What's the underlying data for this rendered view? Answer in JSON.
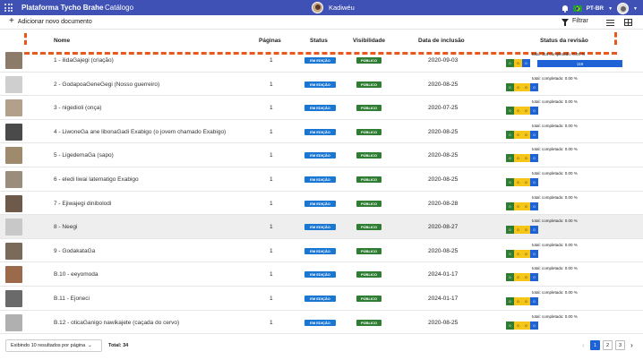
{
  "topbar": {
    "brand": "Plataforma Tycho Brahe",
    "section": "Catálogo",
    "user": "Kadiwéu",
    "lang": "PT-BR"
  },
  "toolbar": {
    "add_label": "Adicionar novo documento",
    "filter_label": "Filtrar"
  },
  "table": {
    "headers": {
      "name": "Nome",
      "pages": "Páginas",
      "status": "Status",
      "visibility": "Visibilidade",
      "date": "Data de inclusão",
      "review": "Status da revisão"
    },
    "rows": [
      {
        "name": "1 - ilidaGajegi (criação)",
        "pages": "1",
        "status": "EM EDIÇÃO",
        "visibility": "PÚBLICO",
        "date": "2020-09-03",
        "total": "total:  118  completado:  0.00 %",
        "bar": "118",
        "segs": [
          "0",
          "0",
          "0"
        ],
        "highlight": false
      },
      {
        "name": "2 - GodapoaGeneGegi (Nosso guerreiro)",
        "pages": "1",
        "status": "EM EDIÇÃO",
        "visibility": "PÚBLICO",
        "date": "2020-08-25",
        "total": "total:   completado:  0.00 %",
        "segs": [
          "0",
          "0",
          "0",
          "0"
        ],
        "highlight": false
      },
      {
        "name": "3 - nigedioli (onça)",
        "pages": "1",
        "status": "EM EDIÇÃO",
        "visibility": "PÚBLICO",
        "date": "2020-07-25",
        "total": "total:   completado:  0.00 %",
        "segs": [
          "0",
          "0",
          "0",
          "0"
        ],
        "highlight": false
      },
      {
        "name": "4 - LiwoneGa ane libonaGadi Exabigo (o jovem chamado Exabigo)",
        "pages": "1",
        "status": "EM EDIÇÃO",
        "visibility": "PÚBLICO",
        "date": "2020-08-25",
        "total": "total:   completado:  0.00 %",
        "segs": [
          "0",
          "0",
          "0",
          "0"
        ],
        "highlight": false
      },
      {
        "name": "5 - LigedemaGa (sapo)",
        "pages": "1",
        "status": "EM EDIÇÃO",
        "visibility": "PÚBLICO",
        "date": "2020-08-25",
        "total": "total:   completado:  0.00 %",
        "segs": [
          "0",
          "0",
          "0",
          "0"
        ],
        "highlight": false
      },
      {
        "name": "6 - eledi liwai latematigo Exabigo",
        "pages": "1",
        "status": "EM EDIÇÃO",
        "visibility": "PÚBLICO",
        "date": "2020-08-25",
        "total": "total:   completado:  0.00 %",
        "segs": [
          "0",
          "0",
          "0",
          "0"
        ],
        "highlight": false
      },
      {
        "name": "7 - Ejiwajegi dinibolodi",
        "pages": "1",
        "status": "EM EDIÇÃO",
        "visibility": "PÚBLICO",
        "date": "2020-08-28",
        "total": "total:   completado:  0.00 %",
        "segs": [
          "0",
          "0",
          "0",
          "0"
        ],
        "highlight": false
      },
      {
        "name": "8 - Neegi",
        "pages": "1",
        "status": "EM EDIÇÃO",
        "visibility": "PÚBLICO",
        "date": "2020-08-27",
        "total": "total:   completado:  0.00 %",
        "segs": [
          "0",
          "0",
          "0",
          "0"
        ],
        "highlight": true
      },
      {
        "name": "9 - GodakataGa",
        "pages": "1",
        "status": "EM EDIÇÃO",
        "visibility": "PÚBLICO",
        "date": "2020-08-25",
        "total": "total:   completado:  0.00 %",
        "segs": [
          "0",
          "0",
          "0",
          "0"
        ],
        "highlight": false
      },
      {
        "name": "B.10 - eeyomoda",
        "pages": "1",
        "status": "EM EDIÇÃO",
        "visibility": "PÚBLICO",
        "date": "2024-01-17",
        "total": "total:   completado:  0.00 %",
        "segs": [
          "0",
          "0",
          "0",
          "0"
        ],
        "highlight": false
      },
      {
        "name": "B.11 - Ejoneci",
        "pages": "1",
        "status": "EM EDIÇÃO",
        "visibility": "PÚBLICO",
        "date": "2024-01-17",
        "total": "total:   completado:  0.00 %",
        "segs": [
          "0",
          "0",
          "0",
          "0"
        ],
        "highlight": false
      },
      {
        "name": "B.12 - oticaGanigo nawikajete (caçada do cervo)",
        "pages": "1",
        "status": "EM EDIÇÃO",
        "visibility": "PÚBLICO",
        "date": "2020-08-25",
        "total": "total:   completado:  0.00 %",
        "segs": [
          "0",
          "0",
          "0",
          "0"
        ],
        "highlight": false
      }
    ]
  },
  "footer": {
    "per_page": "Exibindo 10 resultados por página",
    "total": "Total: 34",
    "pages": [
      "1",
      "2",
      "3"
    ],
    "active_page": "1"
  },
  "colors": {
    "topbar": "#3f51b5",
    "edit_badge": "#1976d2",
    "public_badge": "#2e7d32",
    "annotation_dash": "#e8571c"
  }
}
